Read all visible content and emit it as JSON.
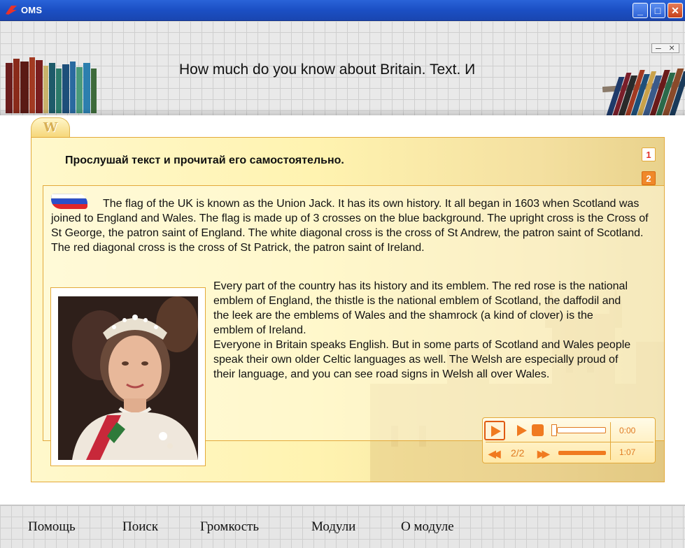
{
  "window": {
    "title": "OMS",
    "minimize_icon": "minimize-icon",
    "maximize_icon": "maximize-icon",
    "close_icon": "close-icon"
  },
  "header": {
    "title": "How much do you know about Britain. Text. И"
  },
  "tab": {
    "label": "W"
  },
  "panel": {
    "instruction": "Прослушай текст и прочитай его самостоятельно.",
    "pages": [
      "1",
      "2"
    ],
    "active_page": "2",
    "paragraph1": "The flag of the UK is known as the Union Jack. It has its own history. It all began in 1603 when Scotland was joined to England and Wales. The flag is made up of 3 crosses on the blue background. The upright cross is the Cross of St George, the patron saint of England. The white diagonal cross is the cross of St Andrew, the patron saint of Scotland. The red diagonal cross is the cross of St Patrick, the patron saint of Ireland.",
    "paragraph2": "Every part of the country has its history and its emblem. The red rose is the national emblem of England, the thistle is the national emblem of Scotland, the daffodil and the leek are the emblems of Wales and the shamrock (a kind of clover) is the emblem of Ireland.",
    "paragraph3": "Everyone in Britain speaks English. But in some parts of Scotland and Wales people speak their own older Celtic languages as well. The Welsh are especially proud of their language, and you can see road signs in Welsh all over Wales."
  },
  "player": {
    "current_time": "0:00",
    "track_counter": "2/2",
    "duration": "1:07",
    "progress": 0
  },
  "footer": {
    "menu": [
      "Помощь",
      "Поиск",
      "Громкость",
      "Модули",
      "О модуле"
    ]
  },
  "colors": {
    "accent": "#f07a20",
    "border": "#e3a93a",
    "titlebar": "#1b4fc4"
  }
}
